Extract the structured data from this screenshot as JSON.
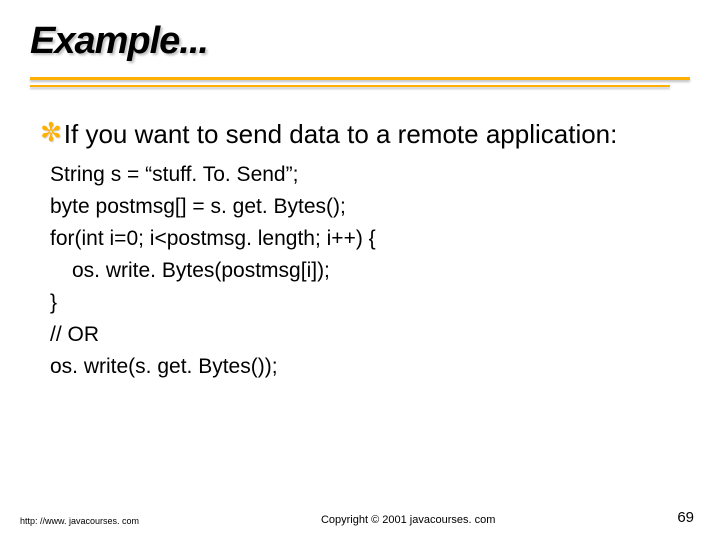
{
  "title": "Example...",
  "bullet": {
    "text": "If you want to send data to a remote application:"
  },
  "code": {
    "l1": "String s = “stuff. To. Send”;",
    "l2": "byte postmsg[] = s. get. Bytes();",
    "l3": "for(int i=0; i<postmsg. length; i++) {",
    "l4": "os. write. Bytes(postmsg[i]);",
    "l5": "}",
    "l6": "// OR",
    "l7": "os. write(s. get. Bytes());"
  },
  "footer": {
    "left": "http: //www. javacourses. com",
    "center": "Copyright © 2001 javacourses. com",
    "right": "69"
  }
}
